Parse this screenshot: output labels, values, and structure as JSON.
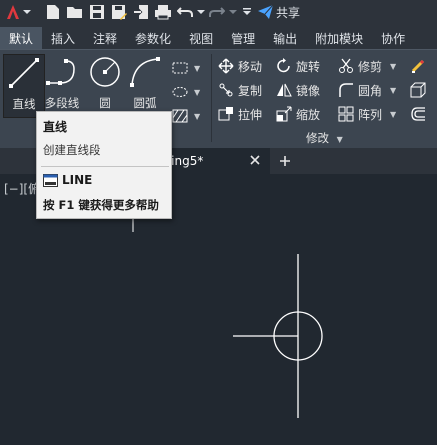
{
  "quick_access": {
    "share_label": "共享"
  },
  "ribbon_tabs": [
    {
      "label": "默认",
      "active": true
    },
    {
      "label": "插入"
    },
    {
      "label": "注释"
    },
    {
      "label": "参数化"
    },
    {
      "label": "视图"
    },
    {
      "label": "管理"
    },
    {
      "label": "输出"
    },
    {
      "label": "附加模块"
    },
    {
      "label": "协作"
    }
  ],
  "draw_panel": {
    "line_label": "直线",
    "polyline_label": "多段线",
    "circle_label": "圆",
    "arc_label": "圆弧"
  },
  "modify_panel": {
    "title": "修改",
    "move": "移动",
    "rotate": "旋转",
    "trim": "修剪",
    "copy": "复制",
    "mirror": "镜像",
    "fillet": "圆角",
    "stretch": "拉伸",
    "scale": "缩放",
    "array": "阵列"
  },
  "file_tabs": {
    "active_tab": "awing5*"
  },
  "viewport": {
    "label": "[−][俯"
  },
  "tooltip": {
    "title": "直线",
    "description": "创建直线段",
    "command": "LINE",
    "help": "按 F1 键获得更多帮助"
  },
  "colors": {
    "background": "#212830",
    "ribbon": "#3c4550",
    "accent_red": "#e0383e",
    "share_blue": "#4aa3ff",
    "pencil_yellow": "#f3c23c"
  }
}
